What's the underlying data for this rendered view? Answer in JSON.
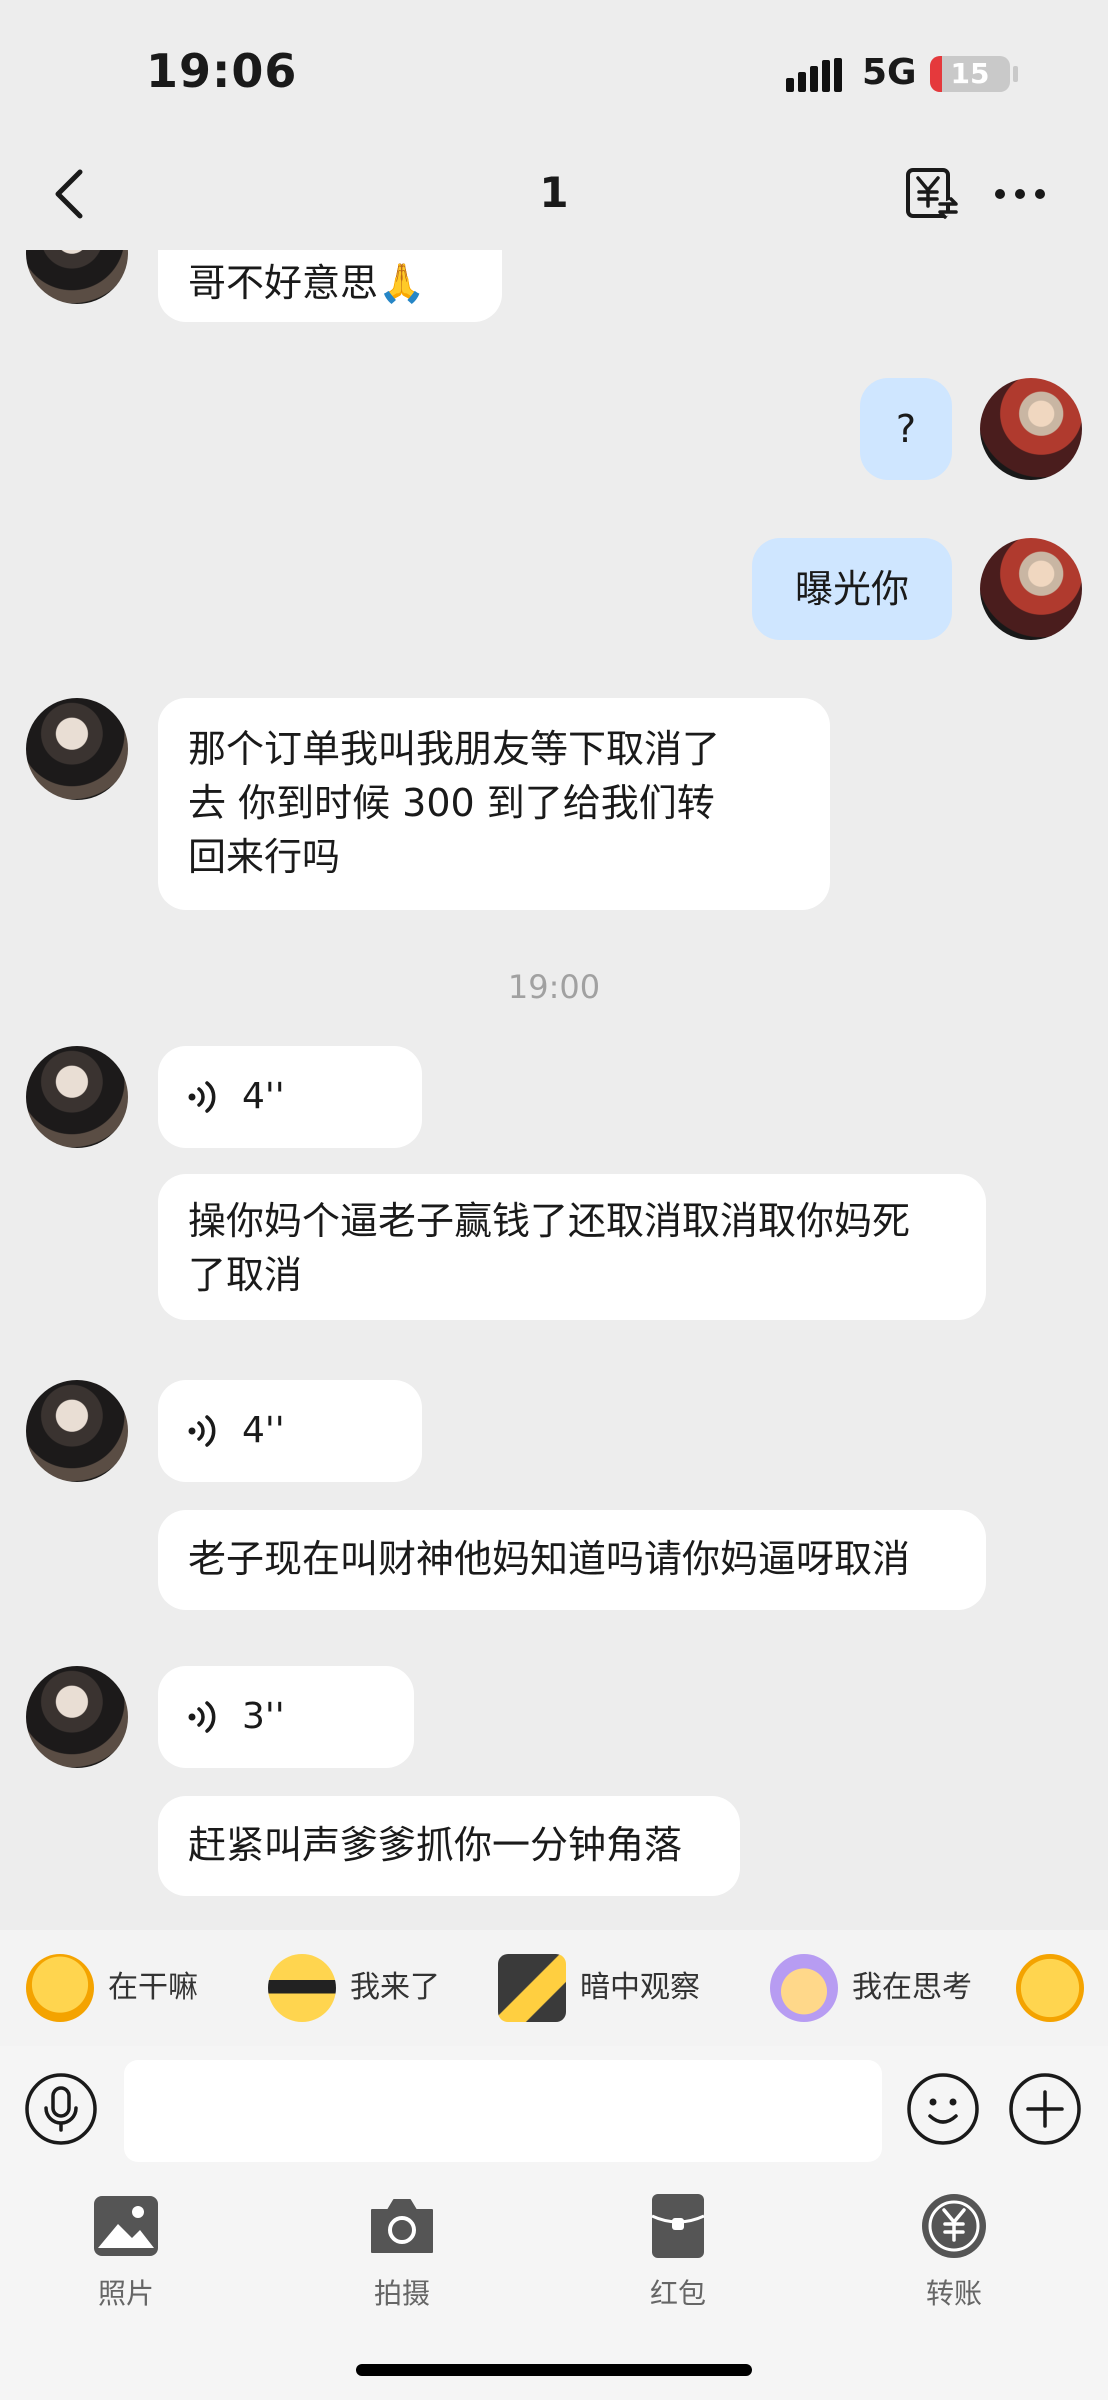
{
  "status_bar": {
    "time": "19:06",
    "network": "5G",
    "battery": "15",
    "battery_level": 0.15,
    "battery_color": "#e5393c"
  },
  "nav": {
    "title": "1",
    "back_icon": "chevron-left-icon",
    "exchange_icon": "yuan-exchange-icon",
    "more_icon": "more-dots-icon"
  },
  "messages": {
    "m1": "哥不好意思🙏",
    "m2": "?",
    "m3": "曝光你",
    "m4_lines": [
      "那个订单我叫我朋友等下取消了",
      "去 你到时候 300 到了给我们转",
      "回来行吗"
    ],
    "timestamp": "19:00",
    "voice1": "4''",
    "m5_lines": [
      "操你妈个逼老子赢钱了还取消取消取你妈死",
      "了取消"
    ],
    "voice2": "4''",
    "m6": "老子现在叫财神他妈知道吗请你妈逼呀取消",
    "voice3": "3''",
    "m7": "赶紧叫声爹爹抓你一分钟角落"
  },
  "stickers": [
    {
      "label": "在干嘛",
      "icon": "sticker-emoji-icon"
    },
    {
      "label": "我来了",
      "icon": "sunglasses-emoji-icon"
    },
    {
      "label": "暗中观察",
      "icon": "peek-emoji-icon"
    },
    {
      "label": "我在思考",
      "icon": "thinking-emoji-icon"
    }
  ],
  "input": {
    "placeholder": ""
  },
  "panel": [
    {
      "label": "照片",
      "icon": "photo-icon"
    },
    {
      "label": "拍摄",
      "icon": "camera-icon"
    },
    {
      "label": "红包",
      "icon": "red-packet-icon"
    },
    {
      "label": "转账",
      "icon": "transfer-icon"
    }
  ],
  "colors": {
    "background": "#ededed",
    "my_bubble": "#cfe6ff",
    "other_bubble": "#ffffff",
    "timestamp": "#a1a1a1"
  }
}
